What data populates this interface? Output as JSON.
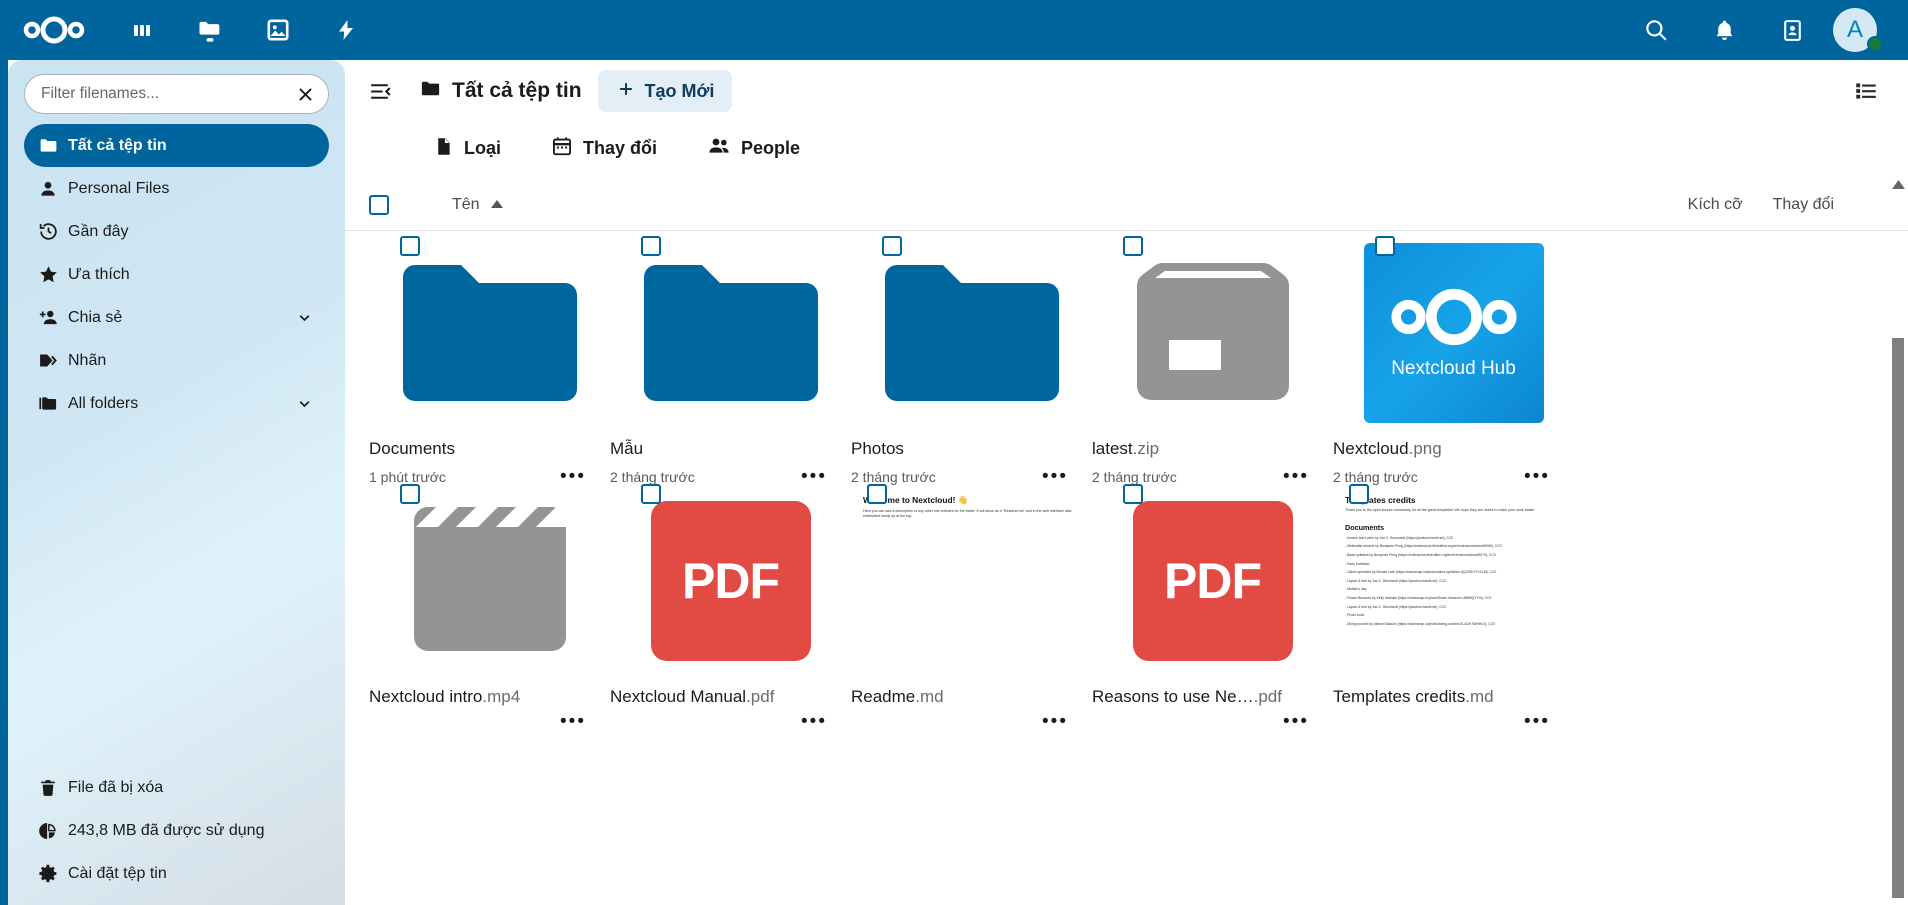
{
  "header": {
    "logo_name": "nextcloud-logo",
    "apps": [
      {
        "name": "dashboard-icon",
        "label": "Dashboard"
      },
      {
        "name": "files-icon",
        "label": "Files"
      },
      {
        "name": "photos-icon",
        "label": "Photos"
      },
      {
        "name": "activity-icon",
        "label": "Activity"
      }
    ],
    "actions": [
      {
        "name": "search-icon",
        "label": "Search"
      },
      {
        "name": "notifications-bell-icon",
        "label": "Notifications"
      },
      {
        "name": "contacts-icon",
        "label": "Contacts"
      }
    ],
    "avatar_initial": "A",
    "status": "online",
    "bg_color": "#00659c"
  },
  "sidebar": {
    "filter": {
      "placeholder": "Filter filenames...",
      "value": "",
      "clear_label": "✕"
    },
    "items": [
      {
        "label": "Tất cả tệp tin",
        "icon": "folder-icon",
        "active": true,
        "chevron": false
      },
      {
        "label": "Personal Files",
        "icon": "person-icon",
        "active": false,
        "chevron": false
      },
      {
        "label": "Gần đây",
        "icon": "history-clock-icon",
        "active": false,
        "chevron": false
      },
      {
        "label": "Ưa thích",
        "icon": "star-icon",
        "active": false,
        "chevron": false
      },
      {
        "label": "Chia sẻ",
        "icon": "share-person-add-icon",
        "active": false,
        "chevron": true
      },
      {
        "label": "Nhãn",
        "icon": "tag-icon",
        "active": false,
        "chevron": false
      },
      {
        "label": "All folders",
        "icon": "folder-multiple-icon",
        "active": false,
        "chevron": true
      }
    ],
    "footer": [
      {
        "label": "File đã bị xóa",
        "icon": "trash-icon"
      },
      {
        "label": "243,8 MB đã được sử dụng",
        "icon": "pie-chart-icon"
      },
      {
        "label": "Cài đặt tệp tin",
        "icon": "gear-icon"
      }
    ]
  },
  "main": {
    "collapse_icon": "collapse-sidebar-icon",
    "breadcrumb": {
      "label": "Tất cả tệp tin",
      "icon": "folder-icon"
    },
    "new_button": {
      "label": "Tạo Mới",
      "icon": "plus-icon"
    },
    "view_toggle": {
      "name": "list-view-icon",
      "label": "List view"
    },
    "filter_chips": [
      {
        "label": "Loại",
        "icon": "file-type-icon"
      },
      {
        "label": "Thay đổi",
        "icon": "calendar-icon"
      },
      {
        "label": "People",
        "icon": "people-icon"
      }
    ],
    "columns": {
      "select_all": false,
      "name": "Tên",
      "sort_direction": "asc",
      "size": "Kích cỡ",
      "modified": "Thay đổi"
    },
    "files": [
      {
        "name": "Documents",
        "ext": "",
        "modified": "1 phút trước",
        "kind": "folder",
        "selected": false
      },
      {
        "name": "Mẫu",
        "ext": "",
        "modified": "2 tháng trước",
        "kind": "folder",
        "selected": false
      },
      {
        "name": "Photos",
        "ext": "",
        "modified": "2 tháng trước",
        "kind": "folder",
        "selected": false
      },
      {
        "name": "latest",
        "ext": ".zip",
        "modified": "2 tháng trước",
        "kind": "archive",
        "selected": false
      },
      {
        "name": "Nextcloud",
        "ext": ".png",
        "modified": "2 tháng trước",
        "kind": "image",
        "selected": false,
        "thumb_text": "Nextcloud Hub"
      },
      {
        "name": "Nextcloud intro",
        "ext": ".mp4",
        "modified": "",
        "kind": "video",
        "selected": false
      },
      {
        "name": "Nextcloud Manual",
        "ext": ".pdf",
        "modified": "",
        "kind": "pdf",
        "selected": false,
        "badge": "PDF"
      },
      {
        "name": "Readme",
        "ext": ".md",
        "modified": "",
        "kind": "markdown",
        "selected": false,
        "doc_title": "Welcome to Nextcloud! 👋",
        "doc_body": "Here you can add a description or any other info relevant for the folder. It will show as a \"Readme.md\" and in the web interface also embedded nicely up at the top."
      },
      {
        "name": "Reasons to use Ne…",
        "ext": ".pdf",
        "modified": "",
        "kind": "pdf",
        "selected": false,
        "badge": "PDF"
      },
      {
        "name": "Templates credits",
        "ext": ".md",
        "modified": "",
        "kind": "markdown",
        "selected": false,
        "doc_title": "Templates credits",
        "doc_body": "Thank you to the open source community for all the great templates! We hope they are useful to make your work easier.",
        "doc_section": "Documents",
        "doc_lines": [
          "- Invoice and Letter by Jan C. Borchardt (https://jancborchardt.net), CC0",
          "- Minimalist résumé by Benjamin Peng (https://extensions.libreoffice.org/en/extensions/show/5069), CC0",
          "- Basic syllabus by Benjamin Peng (https://extensions.libreoffice.org/en/extensions/show/5070), CC0",
          "- Party invitation:",
          "  - Cakes sprinkles by Brooke Lark (https://stocksnap.io/photo/cakes-sprinkles-QQ2WDYY12LM), CC0",
          "  - Layout & text by Jan C. Borchardt (https://jancborchardt.net), CC0",
          "- Mother's day:",
          "  - Flower Blossom by Kelly Ishmael (https://stocksnap.io/photo/flower-blossom-U5MBQYYI4), CC0",
          "  - Layout & text by Jan C. Borchardt (https://jancborchardt.net), CC0",
          "- Photo book",
          "  - Diving snorkel by Aleksei Bakulin (https://stocksnap.io/photo/diving-snorkel-ELADKTWHHL0), CC0"
        ]
      }
    ]
  },
  "scrollbar": {
    "up_arrow": "scroll-up-arrow-icon",
    "down_arrow": "scroll-down-arrow-icon"
  }
}
